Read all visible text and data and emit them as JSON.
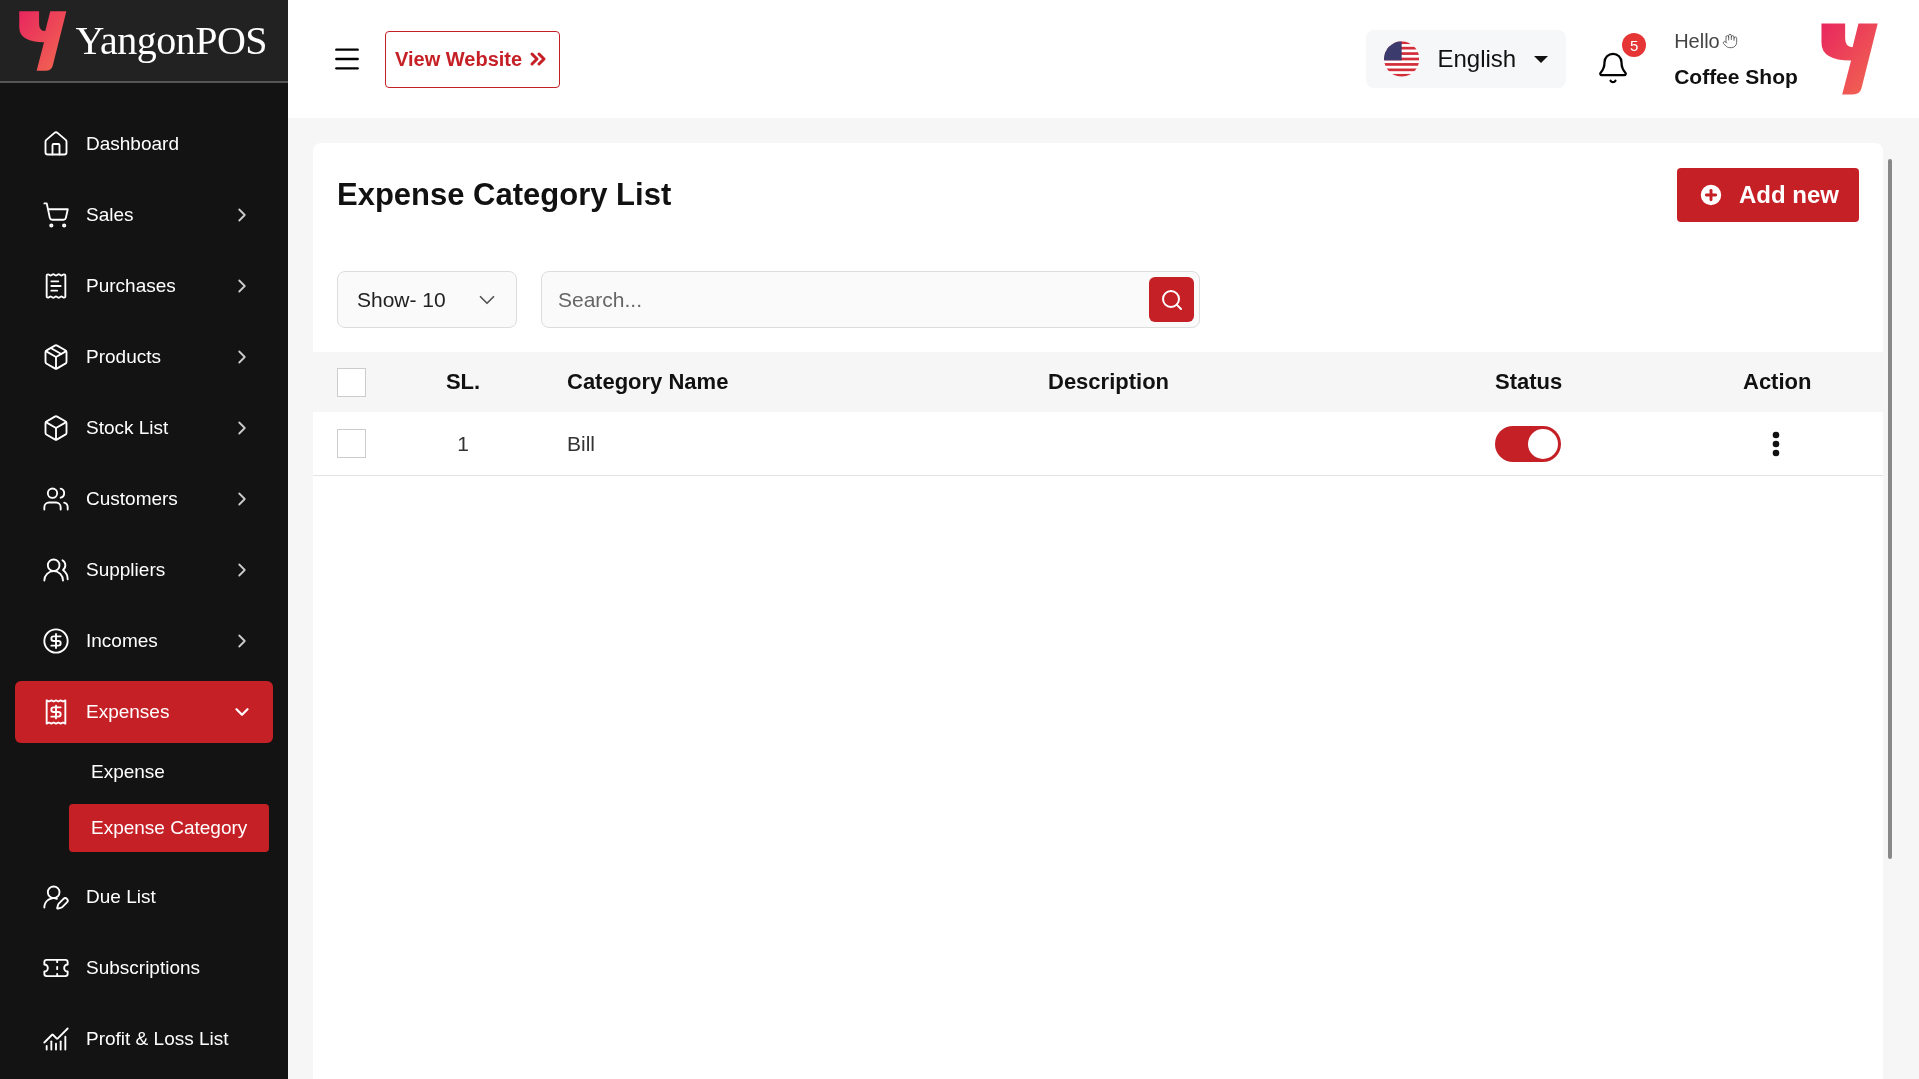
{
  "brand": {
    "name": "YangonPOS"
  },
  "sidebar": {
    "items": [
      {
        "label": "Dashboard",
        "has_submenu": false,
        "selected": false
      },
      {
        "label": "Sales",
        "has_submenu": true,
        "expanded": false,
        "selected": false
      },
      {
        "label": "Purchases",
        "has_submenu": true,
        "expanded": false,
        "selected": false
      },
      {
        "label": "Products",
        "has_submenu": true,
        "expanded": false,
        "selected": false
      },
      {
        "label": "Stock List",
        "has_submenu": true,
        "expanded": false,
        "selected": false
      },
      {
        "label": "Customers",
        "has_submenu": true,
        "expanded": false,
        "selected": false
      },
      {
        "label": "Suppliers",
        "has_submenu": true,
        "expanded": false,
        "selected": false
      },
      {
        "label": "Incomes",
        "has_submenu": true,
        "expanded": false,
        "selected": false
      },
      {
        "label": "Expenses",
        "has_submenu": true,
        "expanded": true,
        "selected": true,
        "children": [
          {
            "label": "Expense",
            "selected": false
          },
          {
            "label": "Expense Category",
            "selected": true
          }
        ]
      },
      {
        "label": "Due List",
        "has_submenu": false,
        "selected": false
      },
      {
        "label": "Subscriptions",
        "has_submenu": false,
        "selected": false
      },
      {
        "label": "Profit & Loss List",
        "has_submenu": false,
        "selected": false
      }
    ]
  },
  "header": {
    "view_website": "View Website",
    "language": "English",
    "notifications": "5",
    "greeting": "Hello",
    "user": "Coffee Shop"
  },
  "page": {
    "title": "Expense Category List",
    "add_button": "Add new",
    "show_select": "Show- 10",
    "search": {
      "placeholder": "Search..."
    }
  },
  "table": {
    "columns": [
      "SL.",
      "Category Name",
      "Description",
      "Status",
      "Action"
    ],
    "all_checked": false,
    "rows": [
      {
        "checked": false,
        "sl": "1",
        "name": "Bill",
        "status_on": true
      }
    ]
  }
}
